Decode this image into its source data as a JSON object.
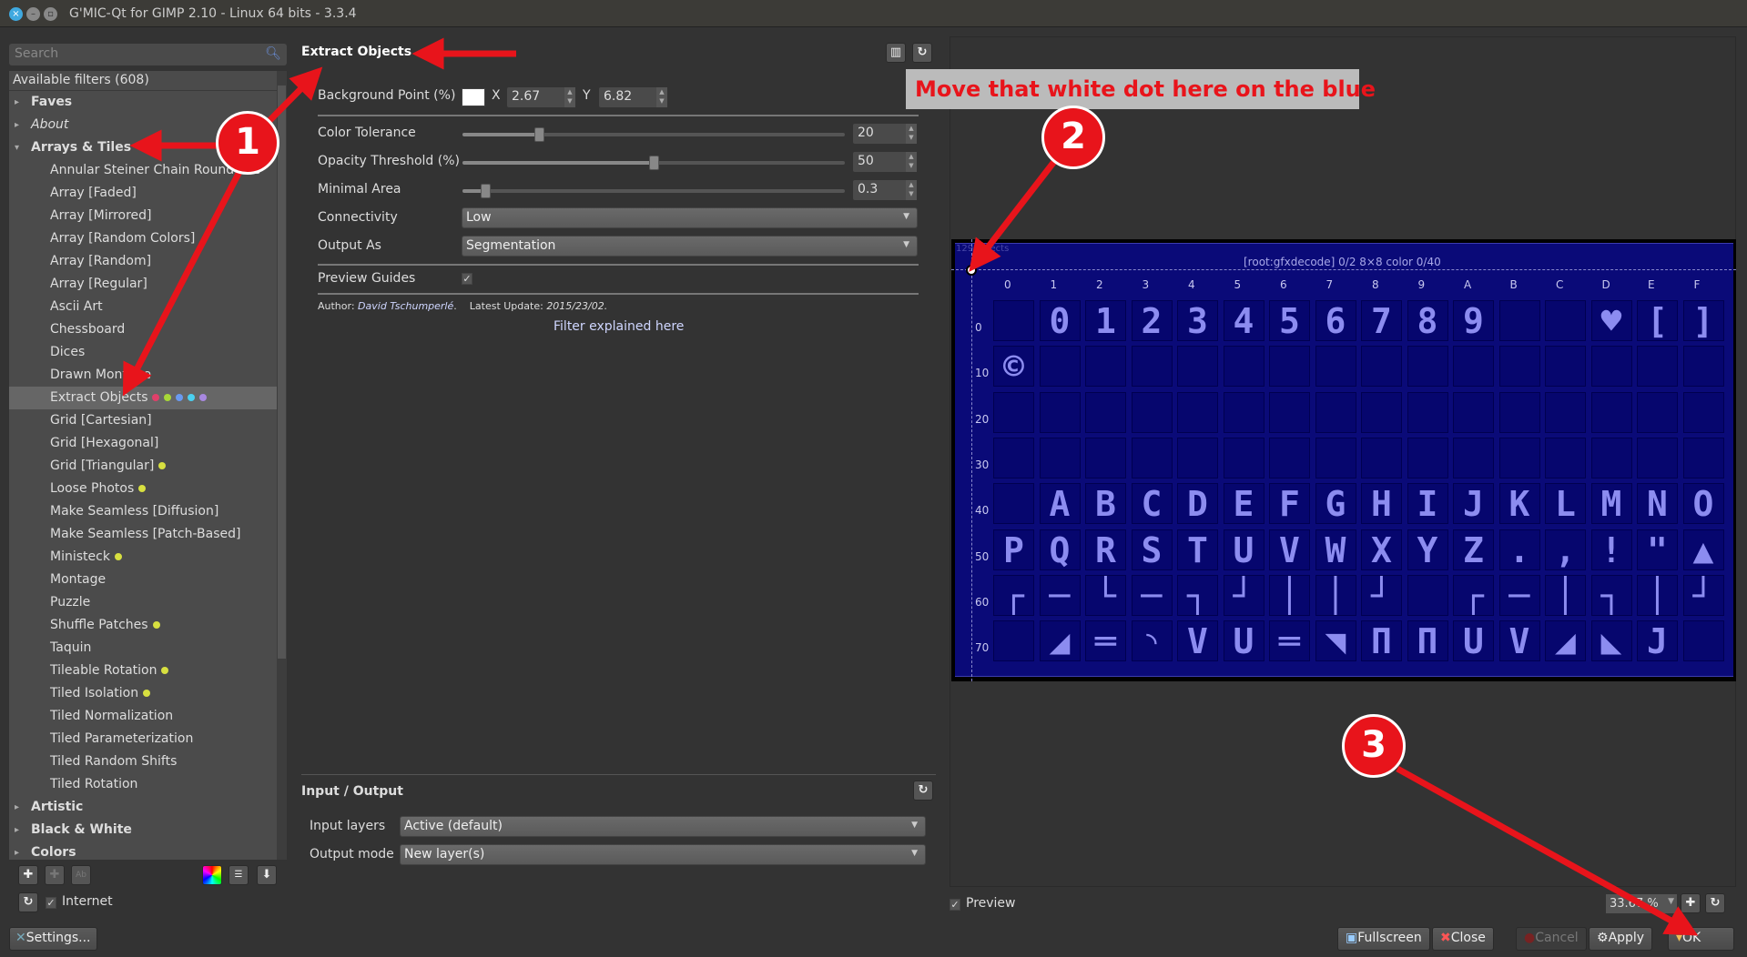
{
  "window": {
    "title": "G'MIC-Qt for GIMP 2.10 - Linux 64 bits - 3.3.4"
  },
  "search": {
    "placeholder": "Search"
  },
  "filters": {
    "header": "Available filters (608)",
    "items": [
      {
        "label": "Faves",
        "kind": "cat"
      },
      {
        "label": "About",
        "kind": "cat-italic"
      },
      {
        "label": "Arrays & Tiles",
        "kind": "cat-open"
      },
      {
        "label": "Annular Steiner Chain Round Tile",
        "kind": "sub"
      },
      {
        "label": "Array [Faded]",
        "kind": "sub"
      },
      {
        "label": "Array [Mirrored]",
        "kind": "sub"
      },
      {
        "label": "Array [Random Colors]",
        "kind": "sub"
      },
      {
        "label": "Array [Random]",
        "kind": "sub"
      },
      {
        "label": "Array [Regular]",
        "kind": "sub"
      },
      {
        "label": "Ascii Art",
        "kind": "sub"
      },
      {
        "label": "Chessboard",
        "kind": "sub"
      },
      {
        "label": "Dices",
        "kind": "sub"
      },
      {
        "label": "Drawn Montage",
        "kind": "sub"
      },
      {
        "label": "Extract Objects",
        "kind": "sub",
        "selected": true,
        "dots": [
          "#e0406a",
          "#a8d838",
          "#6a9af0",
          "#4ad0f0",
          "#a888e0"
        ]
      },
      {
        "label": "Grid [Cartesian]",
        "kind": "sub"
      },
      {
        "label": "Grid [Hexagonal]",
        "kind": "sub"
      },
      {
        "label": "Grid [Triangular]",
        "kind": "sub",
        "dots": [
          "#d8e040"
        ]
      },
      {
        "label": "Loose Photos",
        "kind": "sub",
        "dots": [
          "#d8e040"
        ]
      },
      {
        "label": "Make Seamless [Diffusion]",
        "kind": "sub"
      },
      {
        "label": "Make Seamless [Patch-Based]",
        "kind": "sub"
      },
      {
        "label": "Ministeck",
        "kind": "sub",
        "dots": [
          "#d8e040"
        ]
      },
      {
        "label": "Montage",
        "kind": "sub"
      },
      {
        "label": "Puzzle",
        "kind": "sub"
      },
      {
        "label": "Shuffle Patches",
        "kind": "sub",
        "dots": [
          "#d8e040"
        ]
      },
      {
        "label": "Taquin",
        "kind": "sub"
      },
      {
        "label": "Tileable Rotation",
        "kind": "sub",
        "dots": [
          "#d8e040"
        ]
      },
      {
        "label": "Tiled Isolation",
        "kind": "sub",
        "dots": [
          "#d8e040"
        ]
      },
      {
        "label": "Tiled Normalization",
        "kind": "sub"
      },
      {
        "label": "Tiled Parameterization",
        "kind": "sub"
      },
      {
        "label": "Tiled Random Shifts",
        "kind": "sub"
      },
      {
        "label": "Tiled Rotation",
        "kind": "sub"
      },
      {
        "label": "Artistic",
        "kind": "cat"
      },
      {
        "label": "Black & White",
        "kind": "cat"
      },
      {
        "label": "Colors",
        "kind": "cat"
      }
    ],
    "internet_label": "Internet",
    "settings_label": "Settings..."
  },
  "filter": {
    "title": "Extract Objects",
    "bg_point": {
      "label": "Background Point (%)",
      "x_label": "X",
      "x": "2.67",
      "y_label": "Y",
      "y": "6.82"
    },
    "color_tolerance": {
      "label": "Color Tolerance",
      "value": "20",
      "fraction": 0.2
    },
    "opacity_threshold": {
      "label": "Opacity Threshold (%)",
      "value": "50",
      "fraction": 0.5
    },
    "minimal_area": {
      "label": "Minimal Area",
      "value": "0.3",
      "fraction": 0.06
    },
    "connectivity": {
      "label": "Connectivity",
      "value": "Low"
    },
    "output_as": {
      "label": "Output As",
      "value": "Segmentation"
    },
    "preview_guides": {
      "label": "Preview Guides",
      "checked": true,
      "mark": "✓"
    },
    "author_label": "Author:",
    "author": "David Tschumperlé",
    "author_end": ".",
    "update_label": "Latest Update:",
    "update": "2015/23/02.",
    "link": "Filter explained here"
  },
  "io": {
    "title": "Input / Output",
    "input_label": "Input layers",
    "input_value": "Active (default)",
    "output_label": "Output mode",
    "output_value": "New layer(s)"
  },
  "preview": {
    "objects_text": "129 objects",
    "header": "[root:gfxdecode] 0/2 8×8 color 0/40",
    "cols": [
      "0",
      "1",
      "2",
      "3",
      "4",
      "5",
      "6",
      "7",
      "8",
      "9",
      "A",
      "B",
      "C",
      "D",
      "E",
      "F"
    ],
    "rows": [
      "0",
      "10",
      "20",
      "30",
      "40",
      "50",
      "60",
      "70"
    ],
    "glyphs": [
      [
        "",
        " 0",
        "1",
        "2",
        "3",
        "4",
        "5",
        "6",
        "7",
        "8",
        "9",
        "",
        "",
        "♥",
        "[",
        "]"
      ],
      [
        "©",
        "",
        "",
        "",
        "",
        "",
        "",
        "",
        "",
        "",
        "",
        "",
        "",
        "",
        "",
        ""
      ],
      [
        "",
        "",
        "",
        "",
        "",
        "",
        "",
        "",
        "",
        "",
        "",
        "",
        "",
        "",
        "",
        ""
      ],
      [
        "",
        "",
        "",
        "",
        "",
        "",
        "",
        "",
        "",
        "",
        "",
        "",
        "",
        "",
        "",
        ""
      ],
      [
        "",
        "A",
        "B",
        "C",
        "D",
        "E",
        "F",
        "G",
        "H",
        "I",
        "J",
        "K",
        "L",
        "M",
        "N",
        "O"
      ],
      [
        "P",
        "Q",
        "R",
        "S",
        "T",
        "U",
        "V",
        "W",
        "X",
        "Y",
        "Z",
        ".",
        ",",
        "!",
        "\"",
        "▲"
      ],
      [
        "┌",
        "─",
        "└",
        "─",
        "┐",
        "┘",
        "│",
        "│",
        "┘",
        "",
        "┌",
        "─",
        "│",
        "┐",
        "│",
        "┘"
      ],
      [
        "",
        "◢",
        "═",
        "◝",
        "V",
        "U",
        "═",
        "◥",
        "Π",
        "Π",
        "U",
        "V",
        "◢",
        "◣",
        "J",
        ""
      ]
    ],
    "preview_label": "Preview",
    "zoom": "33.67 %"
  },
  "buttons": {
    "fullscreen": "Fullscreen",
    "close": "Close",
    "cancel": "Cancel",
    "apply": "Apply",
    "ok": "OK"
  },
  "annotations": {
    "note": "Move that white dot here on the blue",
    "n1": "1",
    "n2": "2",
    "n3": "3",
    "color": "#e8141b"
  }
}
